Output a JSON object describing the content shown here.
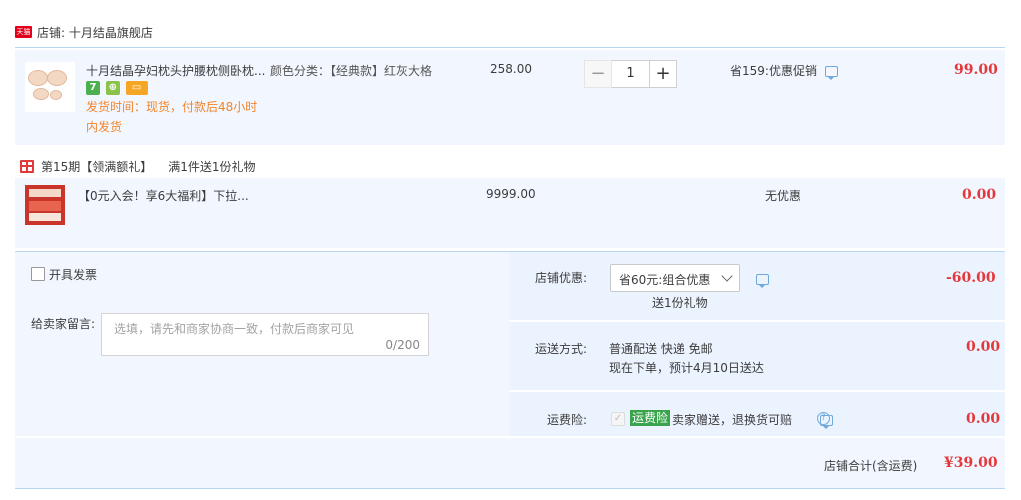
{
  "shop": {
    "badge": "天猫",
    "label": "店铺: 十月结晶旗舰店"
  },
  "item1": {
    "title": "十月结晶孕妇枕头护腰枕侧卧枕...",
    "sku_label": "颜色分类：【经典款】红灰大格",
    "service_icons": [
      "7",
      "⊕",
      "▭"
    ],
    "ship_time_line1": "发货时间：现货，付款后48小时",
    "ship_time_line2": "内发货",
    "unit_price": "258.00",
    "qty": "1",
    "qty_minus": "−",
    "qty_plus": "+",
    "promo": "省159:优惠促销",
    "total": "99.00"
  },
  "gift": {
    "header_period": "第15期【领满额礼】",
    "header_rule": "满1件送1份礼物",
    "title": "【0元入会！享6大福利】下拉...",
    "unit_price": "9999.00",
    "promo": "无优惠",
    "total": "0.00"
  },
  "panel": {
    "invoice_label": "开具发票",
    "message_label": "给卖家留言:",
    "message_placeholder": "选填，请先和商家协商一致，付款后商家可见",
    "message_count": "0/200",
    "shop_discount_label": "店铺优惠:",
    "shop_discount_value": "省60元:组合优惠",
    "shop_discount_note": "送1份礼物",
    "shop_discount_amount": "-60.00",
    "shipping_label": "运送方式:",
    "shipping_method": "普通配送 快递 免邮",
    "shipping_eta": "现在下单，预计4月10日送达",
    "shipping_amount": "0.00",
    "insurance_label": "运费险:",
    "insurance_badge": "运费险",
    "insurance_text": "卖家赠送，退换货可赔",
    "insurance_amount": "0.00",
    "total_label": "店铺合计(含运费)",
    "total_value": "¥39.00"
  },
  "colors": {
    "price_red": "#e4393c",
    "ship_orange": "#f1852c",
    "panel_bg": "#f2f7ff",
    "insurance_green": "#3aa44d"
  }
}
